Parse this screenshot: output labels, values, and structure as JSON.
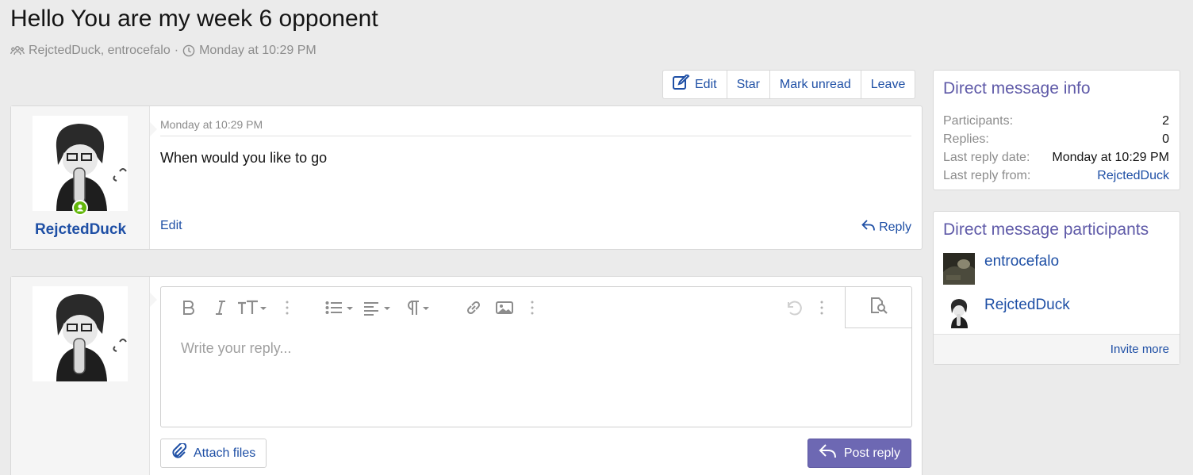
{
  "conversation": {
    "title": "Hello You are my week 6 opponent",
    "participants_line": "RejctedDuck, entrocefalo",
    "separator": "·",
    "date": "Monday at 10:29 PM"
  },
  "actions": {
    "edit": "Edit",
    "star": "Star",
    "mark_unread": "Mark unread",
    "leave": "Leave"
  },
  "message": {
    "author": "RejctedDuck",
    "date": "Monday at 10:29 PM",
    "body": "When would you like to go",
    "edit_label": "Edit",
    "reply_label": "Reply"
  },
  "editor": {
    "placeholder": "Write your reply...",
    "attach_label": "Attach files",
    "post_label": "Post reply",
    "toolbar_icons": [
      "bold-icon",
      "italic-icon",
      "text-size-icon",
      "more-vertical-icon",
      "list-icon",
      "align-icon",
      "paragraph-icon",
      "more-vertical-icon",
      "link-icon",
      "image-icon",
      "more-vertical-icon",
      "undo-icon",
      "more-vertical-icon",
      "preview-icon"
    ]
  },
  "info": {
    "heading": "Direct message info",
    "rows": [
      {
        "key": "Participants:",
        "value": "2"
      },
      {
        "key": "Replies:",
        "value": "0"
      },
      {
        "key": "Last reply date:",
        "value": "Monday at 10:29 PM"
      },
      {
        "key": "Last reply from:",
        "value": "RejctedDuck"
      }
    ]
  },
  "participants": {
    "heading": "Direct message participants",
    "list": [
      "entrocefalo",
      "RejctedDuck"
    ],
    "invite_label": "Invite more"
  },
  "colors": {
    "link": "#1e4fa5",
    "accent": "#6d68b3",
    "heading": "#5f5aa8",
    "online": "#63b70a",
    "background": "#ebebeb"
  }
}
